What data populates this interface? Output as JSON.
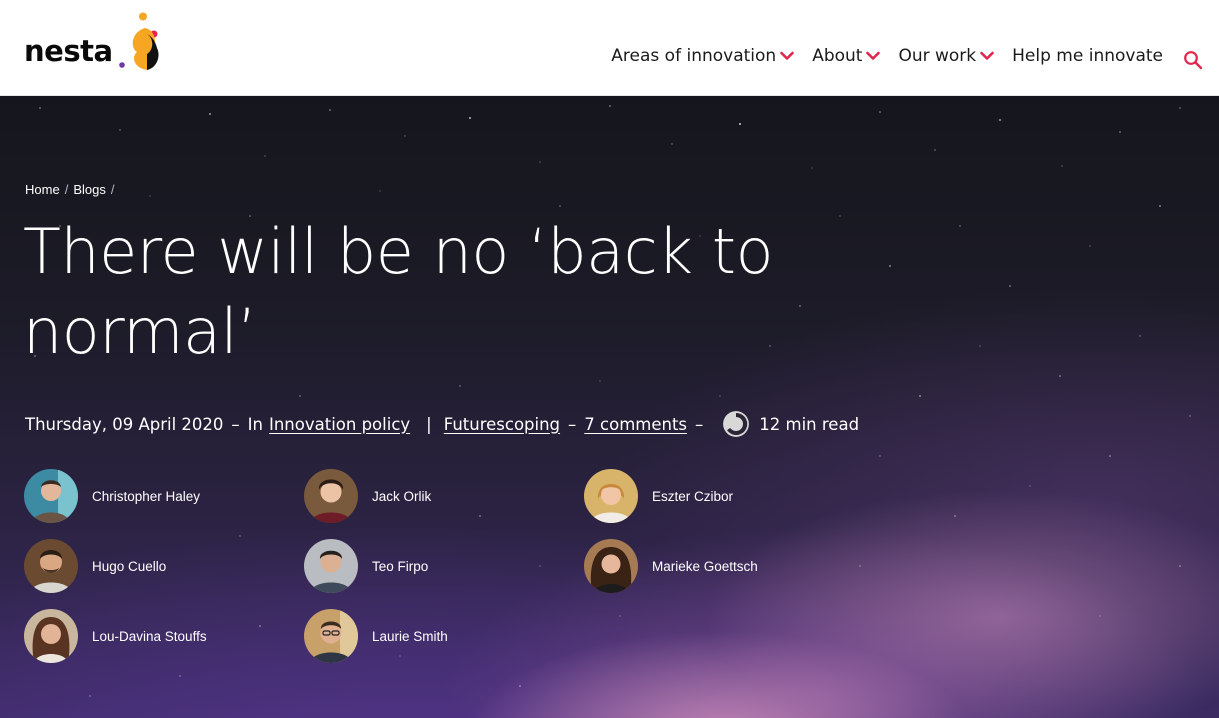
{
  "header": {
    "logo_text": "nesta",
    "brand_colors": {
      "orange": "#F6A623",
      "red": "#E0264D",
      "purple": "#6E3AA7",
      "dark": "#0A0A0A"
    },
    "nav": [
      {
        "label": "Areas of innovation",
        "has_dropdown": true
      },
      {
        "label": "About",
        "has_dropdown": true
      },
      {
        "label": "Our work",
        "has_dropdown": true
      },
      {
        "label": "Help me innovate",
        "has_dropdown": false
      }
    ],
    "nav_accent": "#E0264D",
    "search_icon": "search-icon"
  },
  "breadcrumb": {
    "items": [
      "Home",
      "Blogs"
    ],
    "separator": "/"
  },
  "article": {
    "title": "There will be no ‘back to normal’",
    "date": "Thursday, 09 April 2020",
    "in_label": "In",
    "category": "Innovation policy",
    "divider": "|",
    "tag": "Futurescoping",
    "comments": "7 comments",
    "dash": "–",
    "read_time": "12 min read",
    "read_time_icon": "clock-icon"
  },
  "authors": [
    {
      "name": "Christopher Haley"
    },
    {
      "name": "Jack Orlik"
    },
    {
      "name": "Eszter Czibor"
    },
    {
      "name": "Hugo Cuello"
    },
    {
      "name": "Teo Firpo"
    },
    {
      "name": "Marieke Goettsch"
    },
    {
      "name": "Lou-Davina Stouffs"
    },
    {
      "name": "Laurie Smith"
    }
  ]
}
